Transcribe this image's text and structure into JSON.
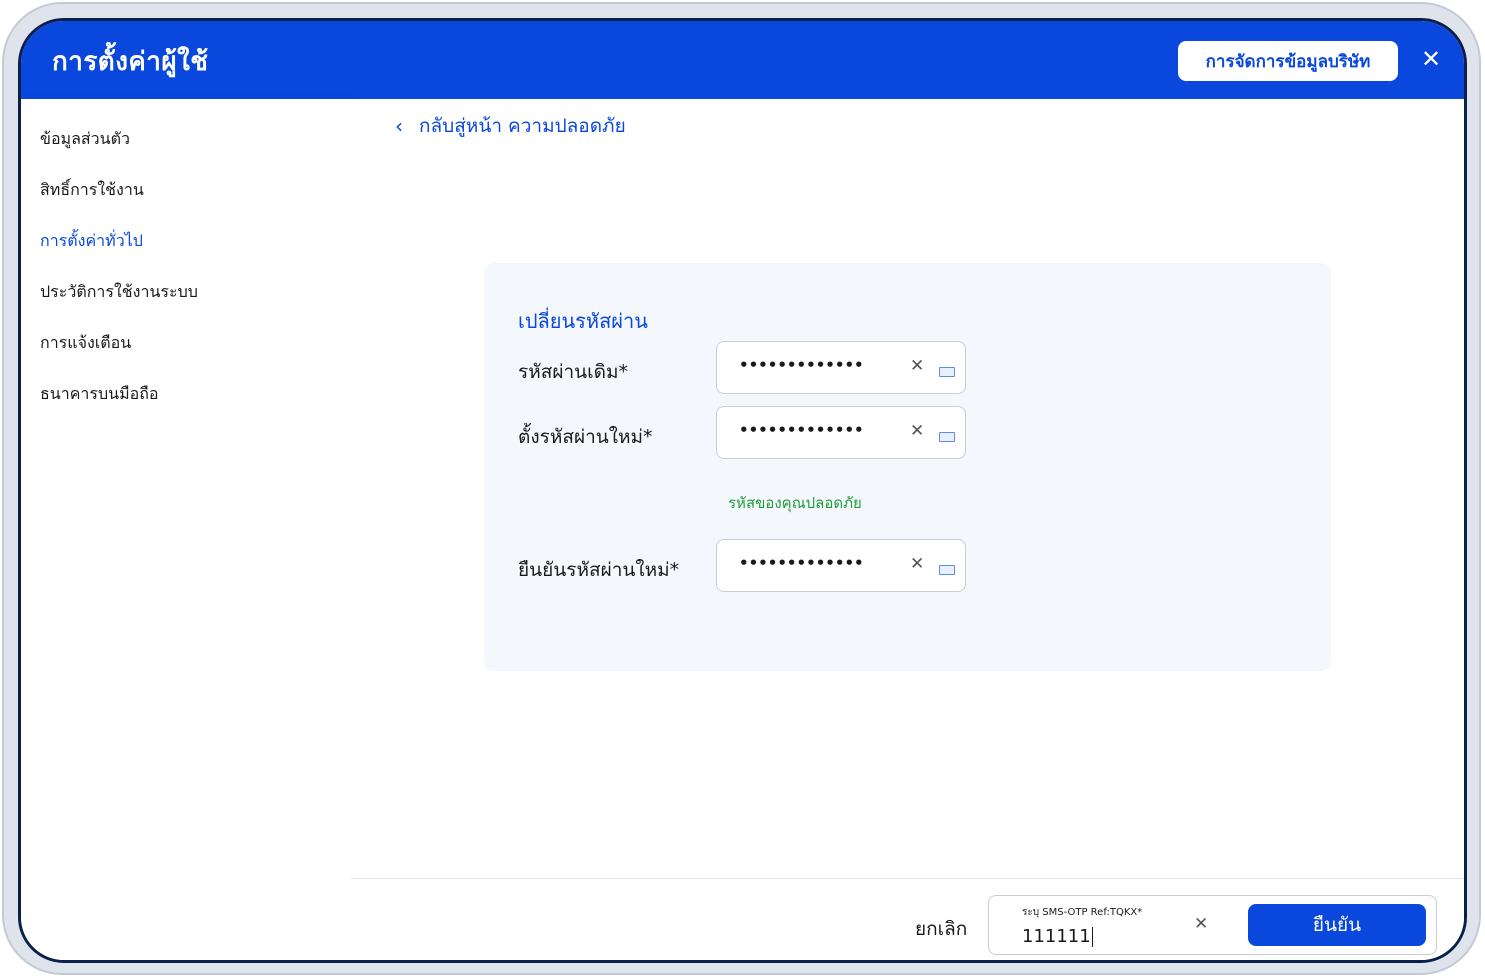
{
  "header": {
    "title": "การตั้งค่าผู้ใช้",
    "company_button": "การจัดการข้อมูลบริษัท",
    "close_icon": "✕"
  },
  "sidebar": {
    "items": [
      {
        "label": "ข้อมูลส่วนตัว",
        "active": false
      },
      {
        "label": "สิทธิ์การใช้งาน",
        "active": false
      },
      {
        "label": "การตั้งค่าทั่วไป",
        "active": true
      },
      {
        "label": "ประวัติการใช้งานระบบ",
        "active": false
      },
      {
        "label": "การแจ้งเตือน",
        "active": false
      },
      {
        "label": "ธนาคารบนมือถือ",
        "active": false
      }
    ]
  },
  "main": {
    "back_icon": "‹",
    "back_link": "กลับสู่หน้า ความปลอดภัย",
    "form": {
      "title": "เปลี่ยนรหัสผ่าน",
      "fields": [
        {
          "label": "รหัสผ่านเดิม*",
          "value": "•••••••••••••"
        },
        {
          "label": "ตั้งรหัสผ่านใหม่*",
          "value": "•••••••••••••"
        },
        {
          "label": "ยืนยันรหัสผ่านใหม่*",
          "value": "•••••••••••••"
        }
      ],
      "strength_hint": "รหัสของคุณปลอดภัย",
      "clear_icon": "✕"
    }
  },
  "footer": {
    "cancel_label": "ยกเลิก",
    "otp_label": "ระบุ SMS-OTP Ref:TQKX*",
    "otp_value": "111111",
    "clear_icon": "✕",
    "confirm_label": "ยืนยัน"
  },
  "colors": {
    "primary": "#0a47dc",
    "success": "#1e9e3e",
    "card_bg": "#f4f7fb"
  }
}
